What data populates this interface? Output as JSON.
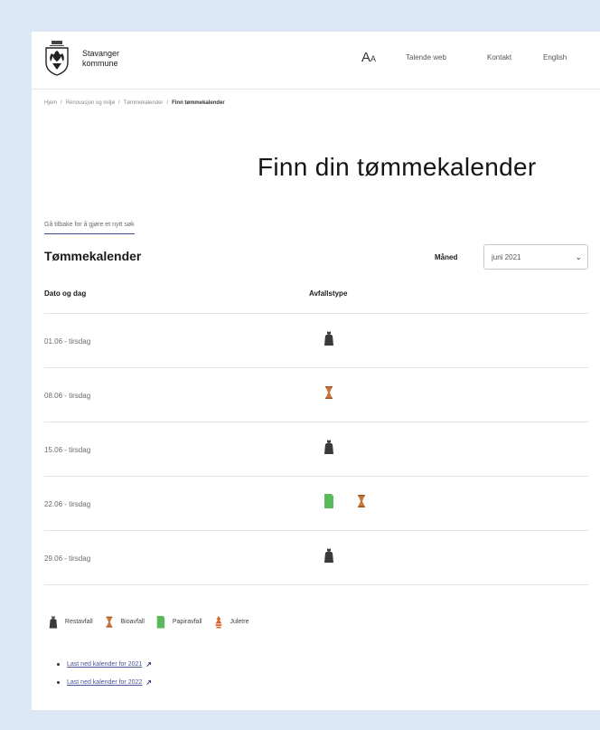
{
  "header": {
    "brand_line1": "Stavanger",
    "brand_line2": "kommune",
    "text_size_glyph_big": "A",
    "text_size_glyph_small": "A",
    "nav": [
      "Talende web",
      "Kontakt",
      "English"
    ]
  },
  "breadcrumb": [
    "Hjem",
    "Renovasjon og miljø",
    "Tømmekalender",
    "Finn tømmekalender"
  ],
  "title": "Finn din tømmekalender",
  "back_link": "Gå tilbake for å gjøre et nytt søk",
  "calendar": {
    "heading": "Tømmekalender",
    "month_label": "Måned",
    "month_value": "juni 2021",
    "columns": [
      "Dato og dag",
      "Avfallstype"
    ],
    "rows": [
      {
        "date": "01.06 - tirsdag",
        "types": [
          "restavfall-icon"
        ]
      },
      {
        "date": "08.06 - tirsdag",
        "types": [
          "bioavfall-icon"
        ]
      },
      {
        "date": "15.06 - tirsdag",
        "types": [
          "restavfall-icon"
        ]
      },
      {
        "date": "22.06 - tirsdag",
        "types": [
          "papiravfall-icon",
          "bioavfall-icon"
        ]
      },
      {
        "date": "29.06 - tirsdag",
        "types": [
          "restavfall-icon"
        ]
      }
    ]
  },
  "legend": [
    {
      "icon": "restavfall-icon",
      "label": "Restavfall"
    },
    {
      "icon": "bioavfall-icon",
      "label": "Bioavfall"
    },
    {
      "icon": "papiravfall-icon",
      "label": "Papiravfall"
    },
    {
      "icon": "juletre-icon",
      "label": "Juletre"
    }
  ],
  "downloads": [
    "Last ned kalender for 2021",
    "Last ned kalender for 2022"
  ],
  "colors": {
    "background": "#dde8f6",
    "restavfall": "#3a3a3a",
    "bioavfall": "#c8763a",
    "papiravfall": "#5cb85c",
    "juletre": "#d9622b",
    "link": "#4a5296"
  }
}
